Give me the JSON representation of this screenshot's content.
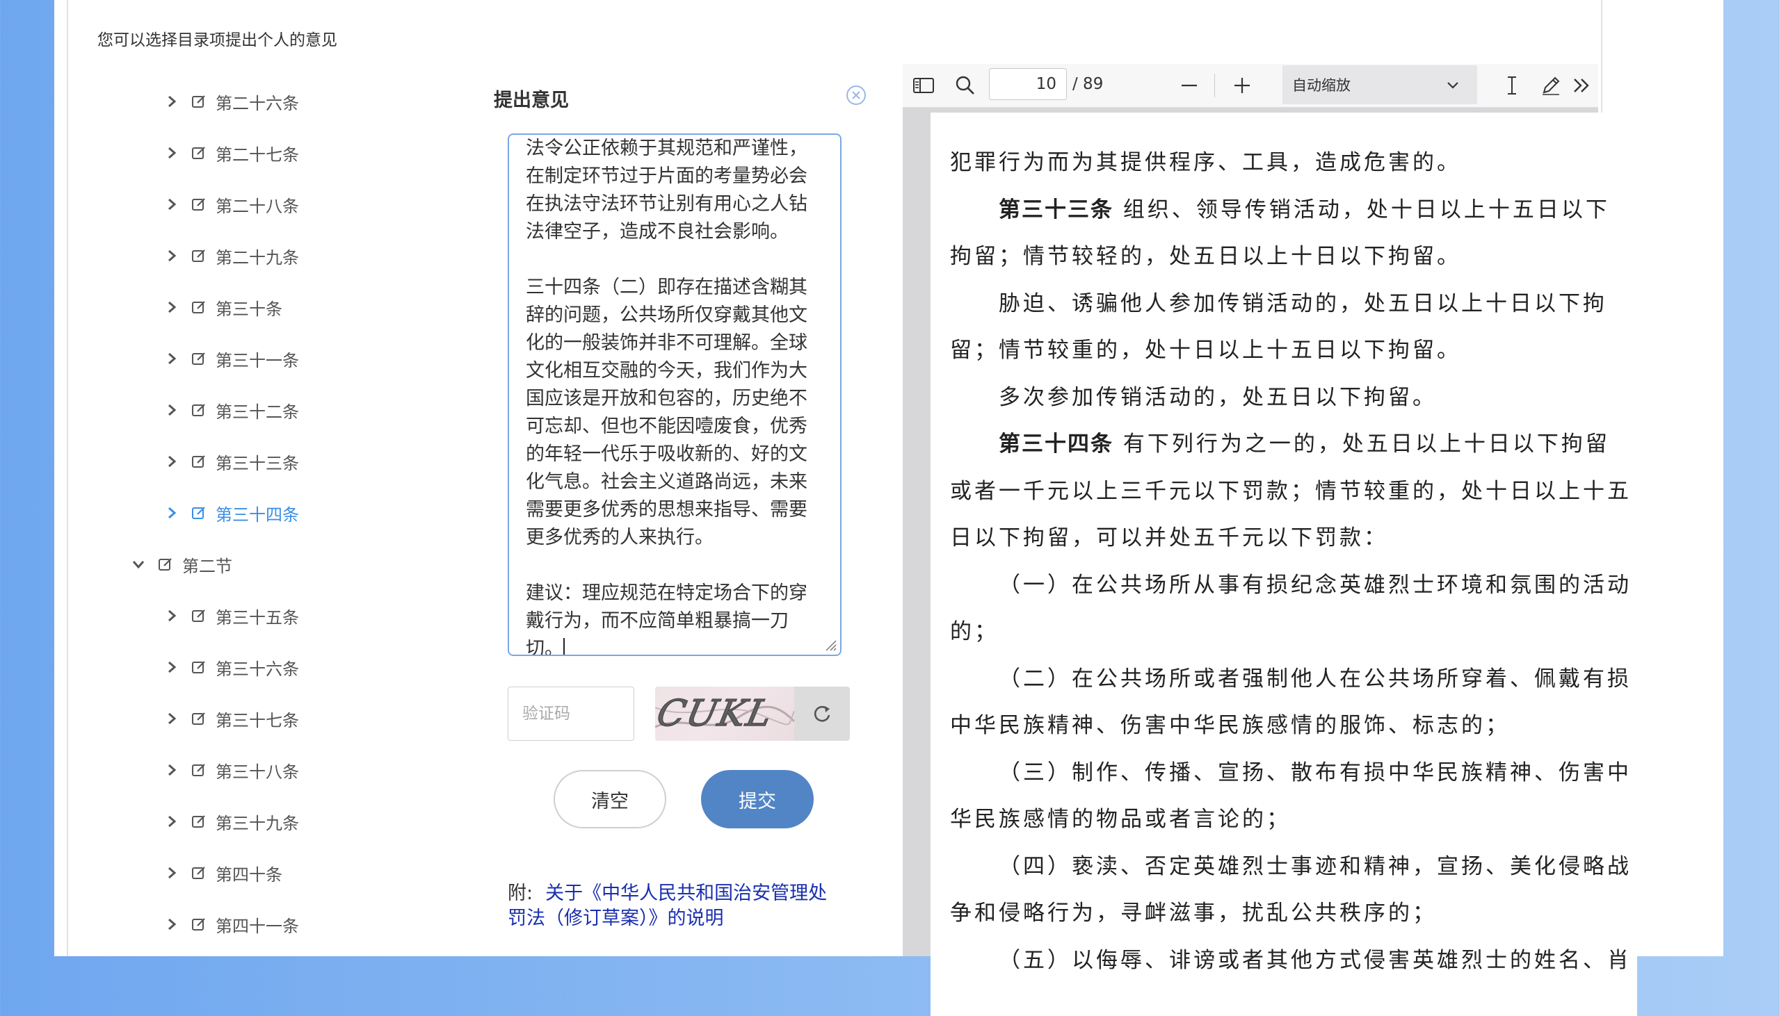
{
  "hint": "您可以选择目录项提出个人的意见",
  "tree": {
    "items": [
      {
        "label": "第二十六条",
        "expanded": false,
        "active": false,
        "level": 2
      },
      {
        "label": "第二十七条",
        "expanded": false,
        "active": false,
        "level": 2
      },
      {
        "label": "第二十八条",
        "expanded": false,
        "active": false,
        "level": 2
      },
      {
        "label": "第二十九条",
        "expanded": false,
        "active": false,
        "level": 2
      },
      {
        "label": "第三十条",
        "expanded": false,
        "active": false,
        "level": 2
      },
      {
        "label": "第三十一条",
        "expanded": false,
        "active": false,
        "level": 2
      },
      {
        "label": "第三十二条",
        "expanded": false,
        "active": false,
        "level": 2
      },
      {
        "label": "第三十三条",
        "expanded": false,
        "active": false,
        "level": 2
      },
      {
        "label": "第三十四条",
        "expanded": false,
        "active": true,
        "level": 2
      },
      {
        "label": "第二节",
        "expanded": true,
        "active": false,
        "level": 1
      },
      {
        "label": "第三十五条",
        "expanded": false,
        "active": false,
        "level": 2
      },
      {
        "label": "第三十六条",
        "expanded": false,
        "active": false,
        "level": 2
      },
      {
        "label": "第三十七条",
        "expanded": false,
        "active": false,
        "level": 2
      },
      {
        "label": "第三十八条",
        "expanded": false,
        "active": false,
        "level": 2
      },
      {
        "label": "第三十九条",
        "expanded": false,
        "active": false,
        "level": 2
      },
      {
        "label": "第四十条",
        "expanded": false,
        "active": false,
        "level": 2
      },
      {
        "label": "第四十一条",
        "expanded": false,
        "active": false,
        "level": 2
      }
    ]
  },
  "panel": {
    "title": "提出意见",
    "comment_lines": [
      "法令公正依赖于其规范和严谨性，",
      "在制定环节过于片面的考量势必会",
      "在执法守法环节让别有用心之人钻",
      "法律空子，造成不良社会影响。",
      "",
      "三十四条（二）即存在描述含糊其",
      "辞的问题，公共场所仅穿戴其他文",
      "化的一般装饰并非不可理解。全球",
      "文化相互交融的今天，我们作为大",
      "国应该是开放和包容的，历史绝不",
      "可忘却、但也不能因噎废食，优秀",
      "的年轻一代乐于吸收新的、好的文",
      "化气息。社会主义道路尚远，未来",
      "需要更多优秀的思想来指导、需要",
      "更多优秀的人来执行。",
      "",
      "建议：理应规范在特定场合下的穿",
      "戴行为，而不应简单粗暴搞一刀",
      "切。"
    ],
    "captcha_placeholder": "验证码",
    "captcha_text": "CUKL",
    "clear_label": "清空",
    "submit_label": "提交",
    "attach_label": "附:",
    "attach_link_line1": "关于《中华人民共和国治安管理处",
    "attach_link_line2": "罚法（修订草案）》的说明"
  },
  "viewer": {
    "page_current": "10",
    "page_total": "/ 89",
    "zoom_label": "自动缩放",
    "icons": [
      "sidebar-toggle-icon",
      "search-icon",
      "zoom-out-icon",
      "zoom-in-icon",
      "text-cursor-icon",
      "pen-icon",
      "more-tools-icon"
    ],
    "lines": [
      {
        "bold": "",
        "text": "犯罪行为而为其提供程序、工具，造成危害的。"
      },
      {
        "bold": "第三十三条",
        "text": "组织、领导传销活动，处十日以上十五日以下"
      },
      {
        "bold": "",
        "text": "拘留；情节较轻的，处五日以上十日以下拘留。"
      },
      {
        "bold": "",
        "text": "胁迫、诱骗他人参加传销活动的，处五日以上十日以下拘"
      },
      {
        "bold": "",
        "text": "留；情节较重的，处十日以上十五日以下拘留。"
      },
      {
        "bold": "",
        "text": "多次参加传销活动的，处五日以下拘留。"
      },
      {
        "bold": "第三十四条",
        "text": "有下列行为之一的，处五日以上十日以下拘留"
      },
      {
        "bold": "",
        "text": "或者一千元以上三千元以下罚款；情节较重的，处十日以上十五"
      },
      {
        "bold": "",
        "text": "日以下拘留，可以并处五千元以下罚款："
      },
      {
        "bold": "",
        "text": "（一）在公共场所从事有损纪念英雄烈士环境和氛围的活动"
      },
      {
        "bold": "",
        "text": "的；"
      },
      {
        "bold": "",
        "text": "（二）在公共场所或者强制他人在公共场所穿着、佩戴有损"
      },
      {
        "bold": "",
        "text": "中华民族精神、伤害中华民族感情的服饰、标志的；"
      },
      {
        "bold": "",
        "text": "（三）制作、传播、宣扬、散布有损中华民族精神、伤害中"
      },
      {
        "bold": "",
        "text": "华民族感情的物品或者言论的；"
      },
      {
        "bold": "",
        "text": "（四）亵渎、否定英雄烈士事迹和精神，宣扬、美化侵略战"
      },
      {
        "bold": "",
        "text": "争和侵略行为，寻衅滋事，扰乱公共秩序的；"
      },
      {
        "bold": "",
        "text": "（五）以侮辱、诽谤或者其他方式侵害英雄烈士的姓名、肖"
      }
    ]
  },
  "colors": {
    "accent": "#3a8ee6",
    "submit": "#5185c6",
    "link": "#1a2fae",
    "background_left": "#6fa7ef",
    "background_right": "#a9cdf6"
  }
}
